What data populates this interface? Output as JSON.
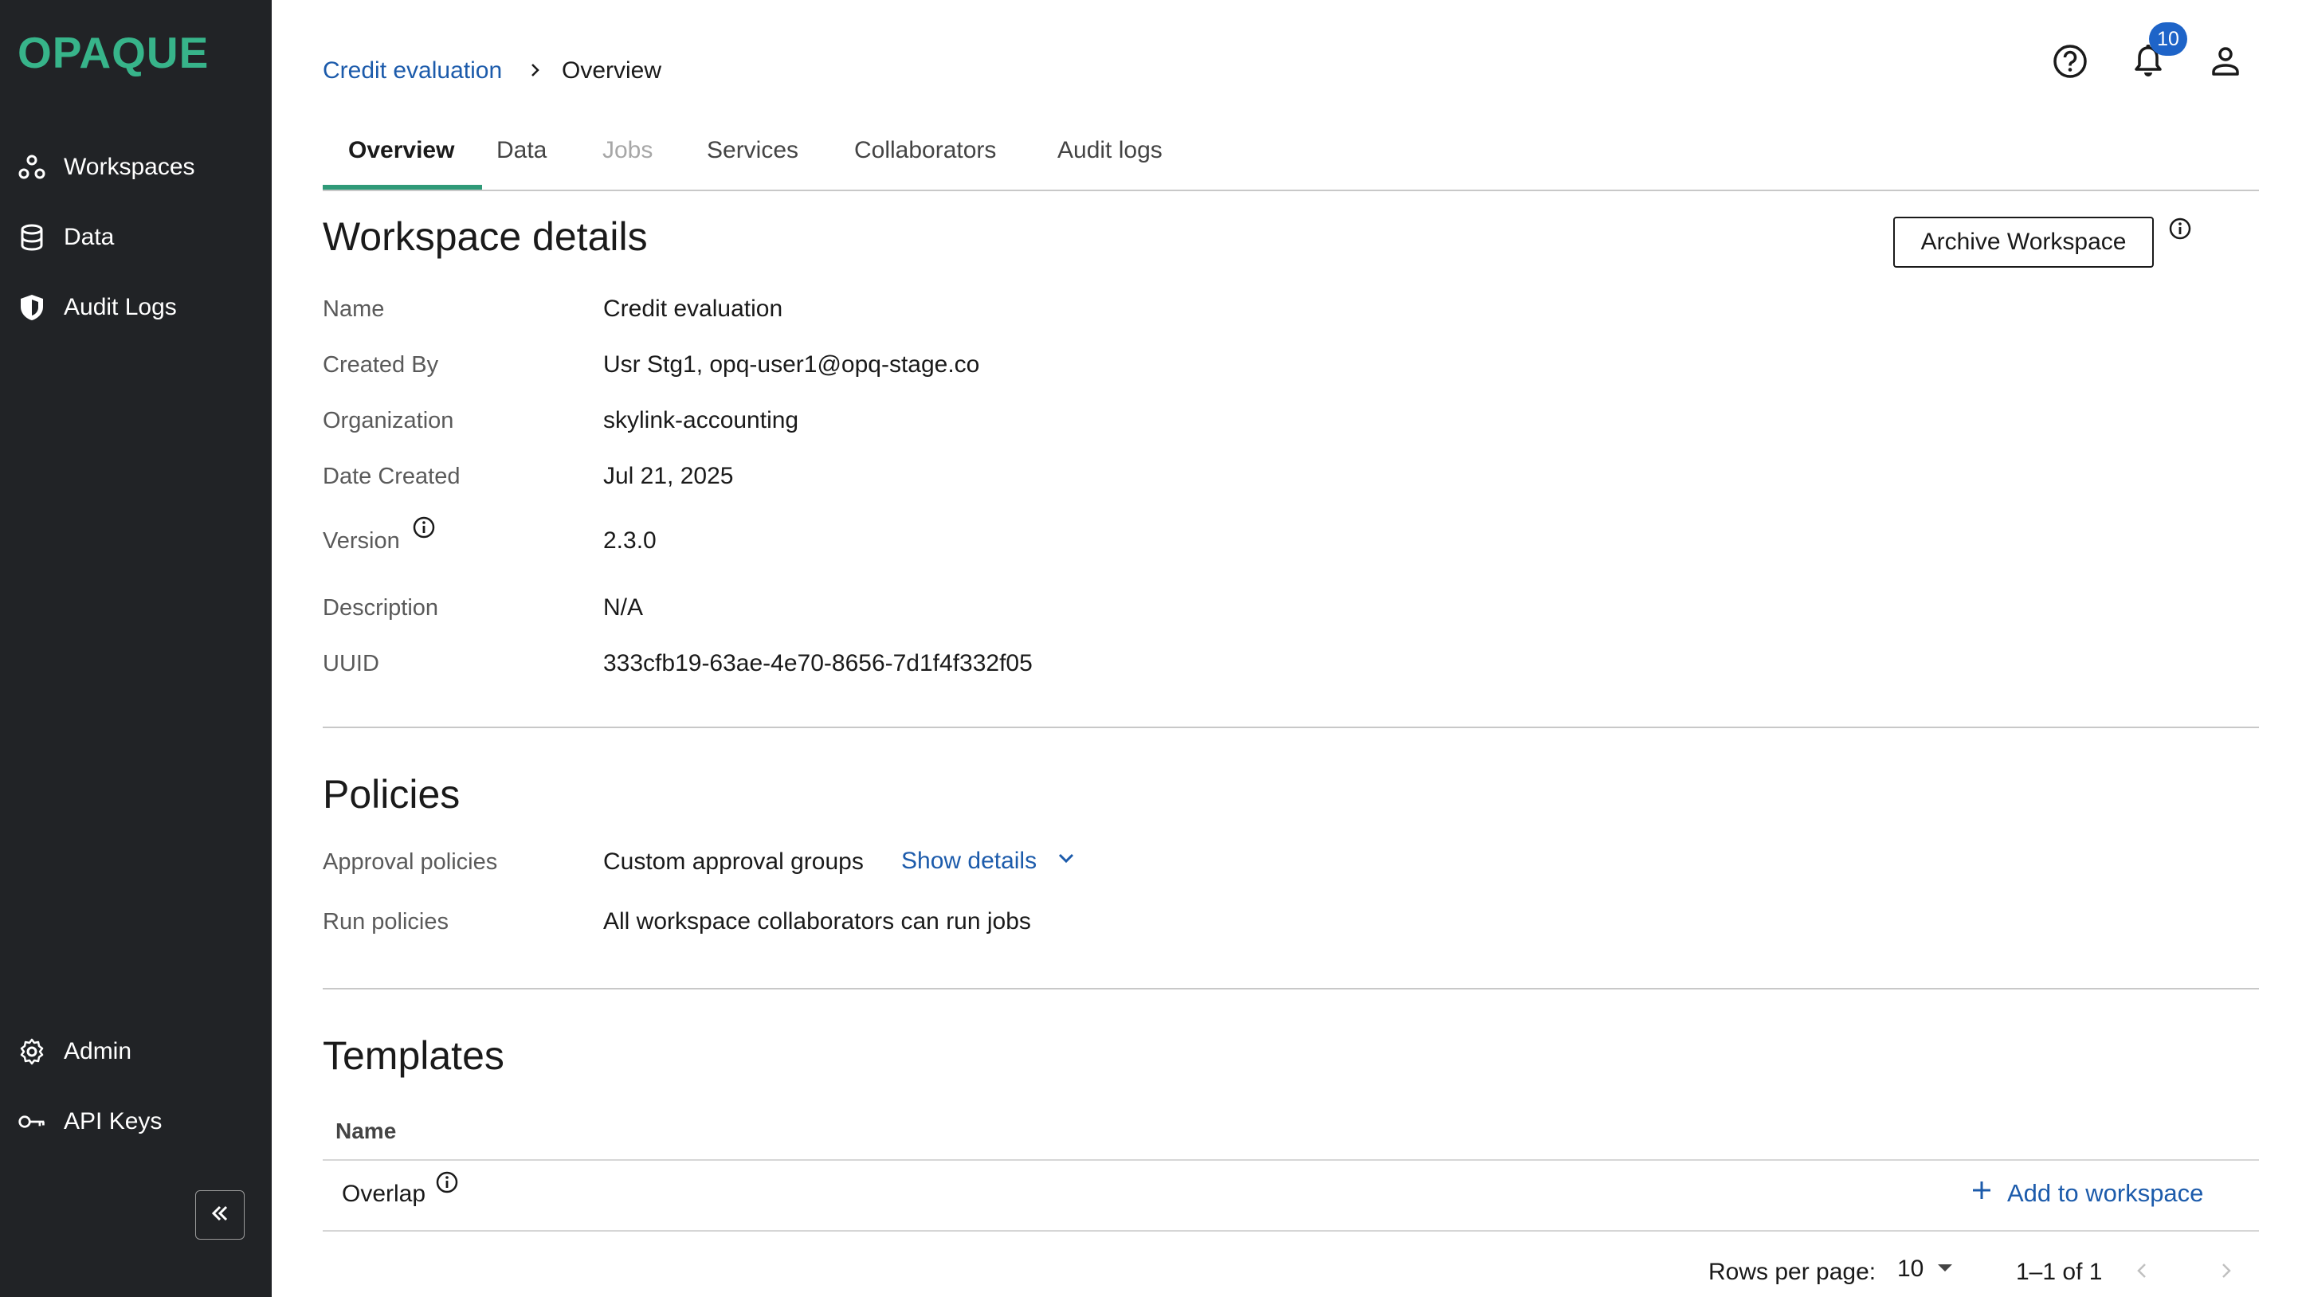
{
  "brand": {
    "logo_text": "OPAQUE",
    "accent_color": "#37b48a"
  },
  "sidebar": {
    "items": [
      {
        "label": "Workspaces",
        "icon": "workspaces-icon"
      },
      {
        "label": "Data",
        "icon": "database-icon"
      },
      {
        "label": "Audit Logs",
        "icon": "shield-icon"
      }
    ],
    "bottom_items": [
      {
        "label": "Admin",
        "icon": "gear-icon"
      },
      {
        "label": "API Keys",
        "icon": "key-icon"
      }
    ],
    "collapse_icon": "double-chevron-left-icon"
  },
  "breadcrumb": {
    "parent": "Credit evaluation",
    "current": "Overview"
  },
  "header": {
    "notification_count": "10",
    "icons": [
      "help-icon",
      "bell-icon",
      "user-icon"
    ]
  },
  "tabs": [
    {
      "label": "Overview",
      "state": "active"
    },
    {
      "label": "Data",
      "state": "normal"
    },
    {
      "label": "Jobs",
      "state": "disabled"
    },
    {
      "label": "Services",
      "state": "normal"
    },
    {
      "label": "Collaborators",
      "state": "normal"
    },
    {
      "label": "Audit logs",
      "state": "normal"
    }
  ],
  "workspace_details": {
    "title": "Workspace details",
    "archive_label": "Archive Workspace",
    "rows": [
      {
        "label": "Name",
        "value": "Credit evaluation"
      },
      {
        "label": "Created By",
        "value": "Usr Stg1, opq-user1@opq-stage.co"
      },
      {
        "label": "Organization",
        "value": "skylink-accounting"
      },
      {
        "label": "Date Created",
        "value": "Jul 21, 2025"
      },
      {
        "label": "Version",
        "value": "2.3.0"
      },
      {
        "label": "Description",
        "value": "N/A"
      },
      {
        "label": "UUID",
        "value": "333cfb19-63ae-4e70-8656-7d1f4f332f05"
      }
    ]
  },
  "policies": {
    "title": "Policies",
    "rows": [
      {
        "label": "Approval policies",
        "value": "Custom approval groups",
        "link": "Show details"
      },
      {
        "label": "Run policies",
        "value": "All workspace collaborators can run jobs"
      }
    ]
  },
  "templates": {
    "title": "Templates",
    "column_header": "Name",
    "rows": [
      {
        "name": "Overlap",
        "action": "Add to workspace"
      }
    ],
    "pagination": {
      "rows_per_page_label": "Rows per page:",
      "rows_per_page": "10",
      "range": "1–1 of 1"
    }
  }
}
